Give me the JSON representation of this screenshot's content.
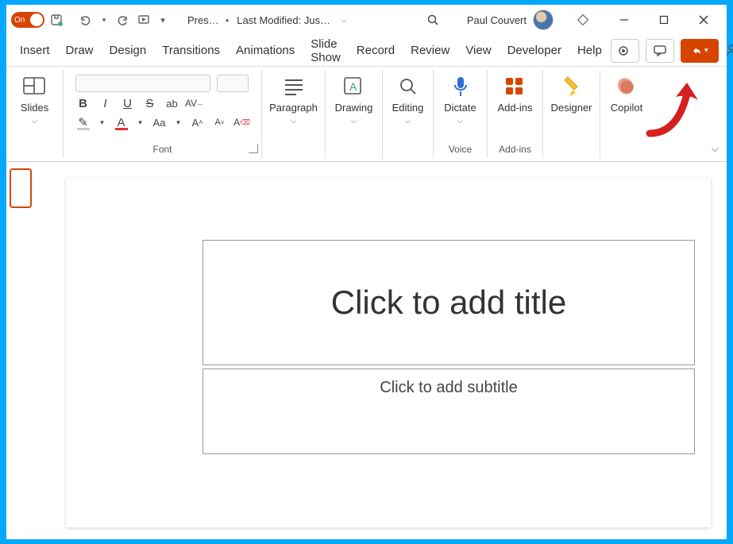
{
  "titleBar": {
    "autosave_label": "On",
    "doc_name": "Pres…",
    "dot": "•",
    "last_modified": "Last Modified: Jus…",
    "user_name": "Paul Couvert"
  },
  "tabs": {
    "insert": "Insert",
    "draw": "Draw",
    "design": "Design",
    "transitions": "Transitions",
    "animations": "Animations",
    "slideshow": "Slide Show",
    "record": "Record",
    "review": "Review",
    "view": "View",
    "developer": "Developer",
    "help": "Help"
  },
  "ribbon": {
    "slides": "Slides",
    "paragraph": "Paragraph",
    "drawing": "Drawing",
    "editing": "Editing",
    "dictate": "Dictate",
    "addins": "Add-ins",
    "designer": "Designer",
    "copilot": "Copilot",
    "font_group": "Font",
    "voice_group": "Voice",
    "addins_group": "Add-ins"
  },
  "slide": {
    "title_placeholder": "Click to add title",
    "subtitle_placeholder": "Click to add subtitle"
  }
}
